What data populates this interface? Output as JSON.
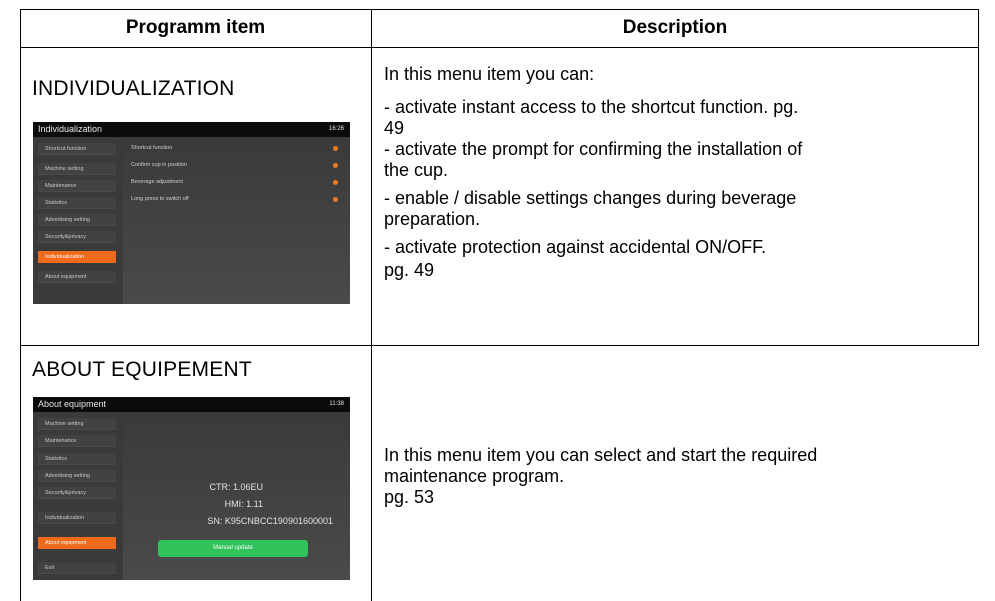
{
  "header": {
    "col1": "Programm item",
    "col2": "Description"
  },
  "rows": [
    {
      "title": "INDIVIDUALIZATION",
      "screen": {
        "title": "Individualization",
        "time": "16:26",
        "sidebar": [
          "Shortcut function",
          "Machine setting",
          "Maintenance",
          "Statistics",
          "Advertising setting",
          "Security&privacy",
          "Individualization",
          "About equipment"
        ],
        "options": [
          "Shortcut function",
          "Confirm cup in position",
          "Beverage adjustment",
          "Long press to switch off"
        ],
        "accent": "#ef6a1a"
      },
      "description": {
        "intro": "In this menu item you can:",
        "line1a": "- activate instant access to the shortcut function. pg.",
        "line1b": "49",
        "line2a": "- activate the prompt for confirming the installation of",
        "line2b": "the cup.",
        "line3a": "- enable / disable settings changes during beverage",
        "line3b": "preparation.",
        "line4": "- activate protection against accidental ON/OFF.",
        "line5": "pg. 49"
      }
    },
    {
      "title": "ABOUT EQUIPEMENT",
      "screen": {
        "title": "About equipment",
        "time": "11:38",
        "sidebar": [
          "Machine setting",
          "Maintenance",
          "Statistics",
          "Advertising setting",
          "Security&privacy",
          "Individualization",
          "About equipment",
          "Exit"
        ],
        "ctr": "CTR: 1.06EU",
        "hmi": "HMI: 1.11",
        "sn": "SN: K95CNBCC190901600001",
        "button": "Manual update",
        "button_color": "#31c25a"
      },
      "description": {
        "line1a": "In this menu item you can select and start the required",
        "line1b": "maintenance program.",
        "line2": "pg. 53"
      }
    }
  ]
}
